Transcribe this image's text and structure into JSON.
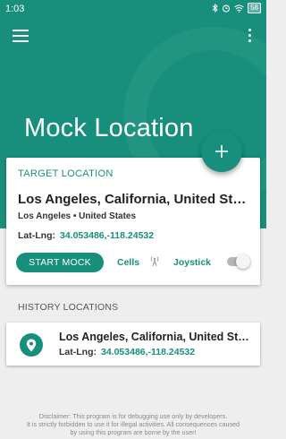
{
  "status_bar": {
    "time": "1:03",
    "battery": "58",
    "icons": [
      "bluetooth-icon",
      "alarm-icon",
      "wifi-icon",
      "battery-icon"
    ]
  },
  "colors": {
    "primary": "#178f7c",
    "background": "#eeeeee"
  },
  "app_bar": {
    "title": "Mock Location",
    "menu_icon": "menu-icon",
    "overflow_icon": "more-vert-icon",
    "fab_icon": "plus-icon"
  },
  "target": {
    "section_label": "TARGET LOCATION",
    "name": "Los Angeles, California, United States",
    "subtitle": "Los Angeles • United States",
    "latlng_label": "Lat-Lng:",
    "latlng_value": "34.053486,-118.24532",
    "start_button": "START MOCK",
    "cells_label": "Cells",
    "joystick_label": "Joystick",
    "joystick_on": false
  },
  "history": {
    "section_label": "HISTORY LOCATIONS",
    "items": [
      {
        "name": "Los Angeles, California, United States",
        "latlng_label": "Lat-Lng:",
        "latlng_value": "34.053486,-118.24532",
        "icon": "location-pin-icon"
      }
    ]
  },
  "disclaimer": {
    "line1": "Disclaimer: This program is for debugging use only by developers.",
    "line2": "It is strictly forbidden to use it for illegal activities. All consequences caused",
    "line3": "by using this program are borne by the user!"
  }
}
